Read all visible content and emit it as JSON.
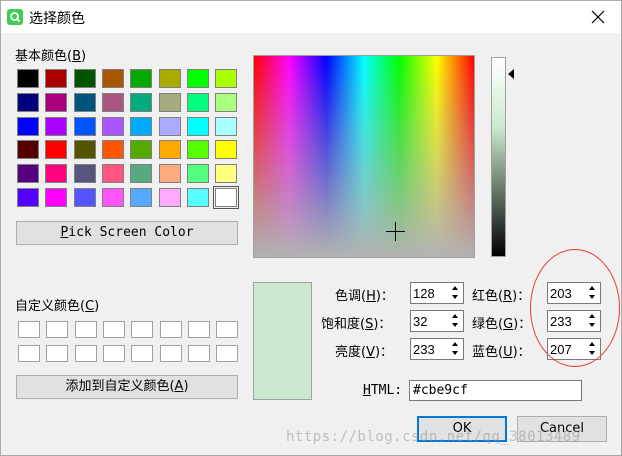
{
  "window": {
    "title": "选择颜色"
  },
  "basic_colors": {
    "label": "基本颜色(",
    "accel": "B",
    "label_end": ")",
    "swatches": [
      [
        "#000000",
        "#aa0000",
        "#005500",
        "#aa5500",
        "#00aa00",
        "#aaaa00",
        "#00ff00",
        "#aaff00"
      ],
      [
        "#00007f",
        "#aa007f",
        "#00557f",
        "#aa557f",
        "#00aa7f",
        "#aaaa7f",
        "#00ff7f",
        "#aaff7f"
      ],
      [
        "#0000ff",
        "#aa00ff",
        "#0055ff",
        "#aa55ff",
        "#00aaff",
        "#aaaaff",
        "#00ffff",
        "#aaffff"
      ],
      [
        "#550000",
        "#ff0000",
        "#555500",
        "#ff5500",
        "#55aa00",
        "#ffaa00",
        "#55ff00",
        "#ffff00"
      ],
      [
        "#55007f",
        "#ff007f",
        "#55557f",
        "#ff557f",
        "#55aa7f",
        "#ffaa7f",
        "#55ff7f",
        "#ffff7f"
      ],
      [
        "#5500ff",
        "#ff00ff",
        "#5555ff",
        "#ff55ff",
        "#55aaff",
        "#ffaaff",
        "#55ffff",
        "#ffffff"
      ]
    ]
  },
  "pick_screen": {
    "accel": "P",
    "rest": "ick Screen Color"
  },
  "custom_colors": {
    "label": "自定义颜色(",
    "accel": "C",
    "label_end": ")"
  },
  "add_custom": {
    "label": "添加到自定义颜色(",
    "accel": "A",
    "label_end": ")"
  },
  "fields": {
    "hue": {
      "label": "色调(",
      "accel": "H",
      "end": ")：",
      "value": "128"
    },
    "sat": {
      "label": "饱和度(",
      "accel": "S",
      "end": ")：",
      "value": "32"
    },
    "val": {
      "label": "亮度(",
      "accel": "V",
      "end": ")：",
      "value": "233"
    },
    "red": {
      "label": "红色(",
      "accel": "R",
      "end": ")：",
      "value": "203"
    },
    "green": {
      "label": "绿色(",
      "accel": "G",
      "end": ")：",
      "value": "233"
    },
    "blue": {
      "label": "蓝色(",
      "accel": "U",
      "end": ")：",
      "value": "207"
    }
  },
  "html": {
    "accel": "H",
    "rest": "TML:",
    "value": "#cbe9cf"
  },
  "buttons": {
    "ok": "OK",
    "cancel": "Cancel"
  },
  "current_color": "#cbe9cf",
  "watermark": "https://blog.csdn.net/qq_38013489"
}
